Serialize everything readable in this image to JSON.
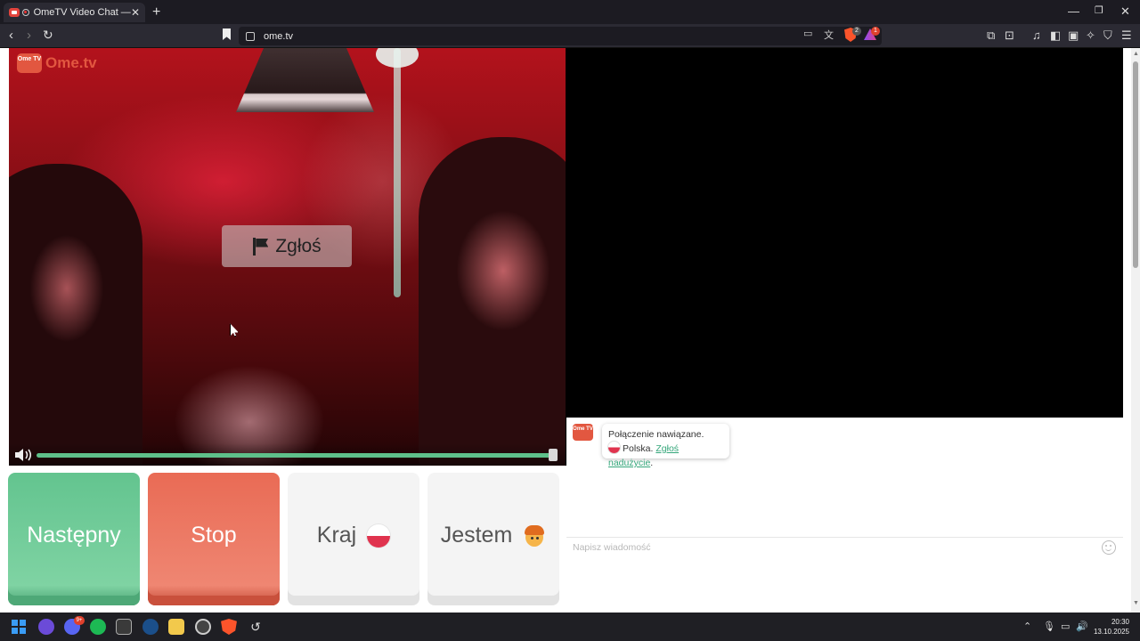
{
  "browser": {
    "tab_title": "OmeTV Video Chat — Omeg",
    "url": "ome.tv",
    "new_tab_icon": "plus-icon",
    "badges": {
      "shield": "2",
      "rewards": "1"
    }
  },
  "site": {
    "logo_badge": "Ome TV",
    "logo_text": "Ome.tv"
  },
  "video": {
    "report_label": "Zgłoś",
    "volume_level_percent": 100
  },
  "controls": {
    "next_label": "Następny",
    "stop_label": "Stop",
    "country_label": "Kraj",
    "gender_label": "Jestem"
  },
  "chat": {
    "logo_badge": "Ome TV",
    "message_line1": "Połączenie nawiązane.",
    "message_country": "Polska.",
    "message_link": "Zgłoś nadużycie",
    "message_end": ".",
    "input_placeholder": "Napisz wiadomość"
  },
  "taskbar": {
    "time": "20:30",
    "date": "13.10.2025",
    "discord_badge": "9+"
  },
  "colors": {
    "next": "#63c48f",
    "stop": "#e96b55",
    "brand": "#e25740",
    "link": "#34a67a"
  }
}
